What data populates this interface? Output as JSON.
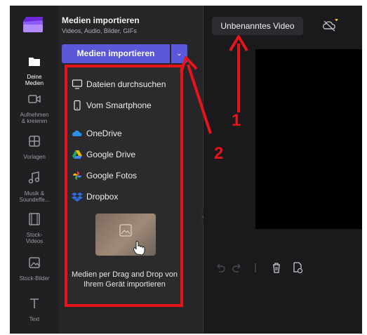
{
  "sidebar": {
    "items": [
      {
        "label": "Deine\nMedien",
        "icon": "folder-icon"
      },
      {
        "label": "Aufnehmen\n& kreieren",
        "icon": "video-camera-icon"
      },
      {
        "label": "Vorlagen",
        "icon": "templates-icon"
      },
      {
        "label": "Musik &\nSoundeffe...",
        "icon": "music-note-icon"
      },
      {
        "label": "Stock-\nVideos",
        "icon": "film-strip-icon"
      },
      {
        "label": "Stock-Bilder",
        "icon": "image-icon"
      },
      {
        "label": "Text",
        "icon": "text-icon"
      }
    ]
  },
  "panel": {
    "title": "Medien importieren",
    "subtitle": "Videos, Audio, Bilder, GIFs",
    "import_button": "Medien importieren",
    "dropdown_glyph": "⌄"
  },
  "menu": {
    "items": [
      {
        "label": "Dateien durchsuchen",
        "icon": "monitor-icon"
      },
      {
        "label": "Vom Smartphone",
        "icon": "smartphone-icon"
      },
      {
        "label": "OneDrive",
        "icon": "onedrive-icon"
      },
      {
        "label": "Google Drive",
        "icon": "google-drive-icon"
      },
      {
        "label": "Google Fotos",
        "icon": "google-photos-icon"
      },
      {
        "label": "Dropbox",
        "icon": "dropbox-icon"
      }
    ],
    "drop_text": "Medien per Drag and Drop von Ihrem Gerät importieren"
  },
  "header": {
    "video_title": "Unbenanntes Video"
  },
  "annotations": {
    "labels": [
      "1",
      "2"
    ]
  },
  "colors": {
    "accent": "#5b57d9",
    "annotation": "#e8141b",
    "background": "#1c1c1e"
  }
}
